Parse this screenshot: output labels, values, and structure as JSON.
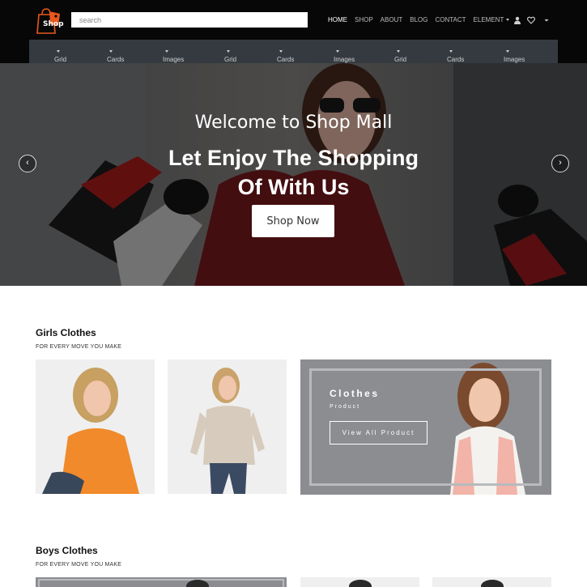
{
  "header": {
    "logo_text": "Shop",
    "search_placeholder": "search",
    "nav": [
      "HOME",
      "SHOP",
      "ABOUT",
      "BLOG",
      "CONTACT",
      "ELEMENT"
    ],
    "icons": [
      "user-icon",
      "heart-icon",
      "chevron-down-icon"
    ]
  },
  "subnav": {
    "items": [
      "Grid",
      "Cards",
      "Images",
      "Grid",
      "Cards",
      "Images",
      "Grid",
      "Cards",
      "Images"
    ]
  },
  "hero": {
    "title": "Welcome to Shop Mall",
    "headline": "Let Enjoy The Shopping Of With Us",
    "button": "Shop Now",
    "prev": "‹",
    "next": "›"
  },
  "girls": {
    "title": "Girls Clothes",
    "subtitle": "FOR EVERY MOVE YOU MAKE",
    "promo_title": "Clothes",
    "promo_sub": "Product",
    "promo_button": "View All Product"
  },
  "boys": {
    "title": "Boys Clothes",
    "subtitle": "FOR EVERY MOVE YOU MAKE"
  },
  "colors": {
    "header_bg": "#070707",
    "subnav_bg": "#343a40",
    "promo_bg": "#8b8d91",
    "logo_accent": "#e8581d"
  }
}
